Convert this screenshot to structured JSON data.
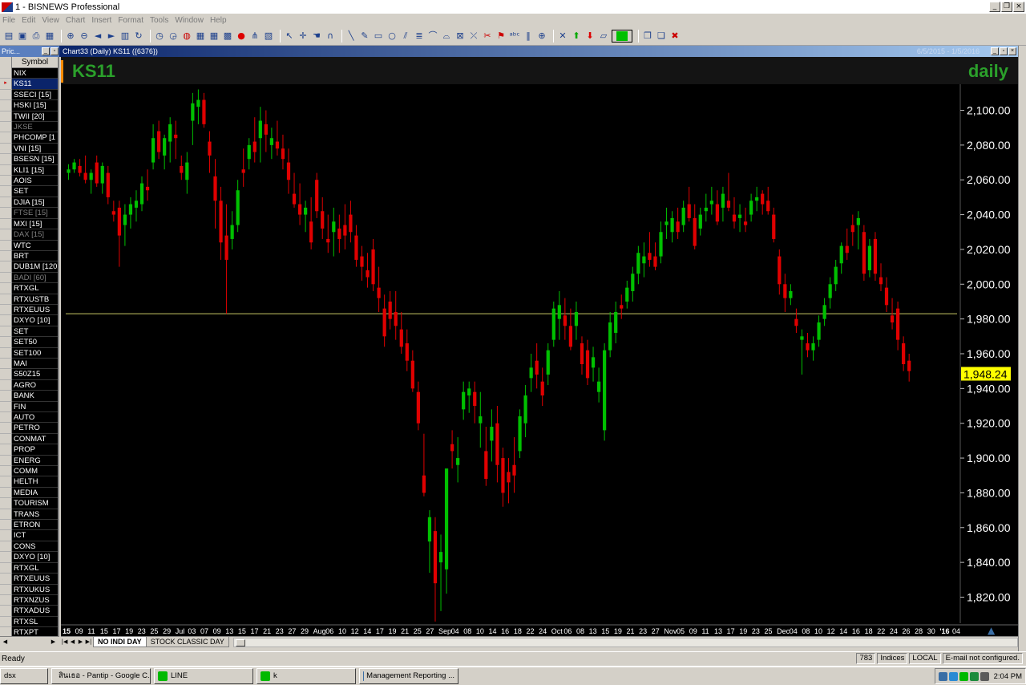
{
  "window": {
    "title": "1 - BISNEWS Professional"
  },
  "menu": [
    "File",
    "Edit",
    "View",
    "Chart",
    "Insert",
    "Format",
    "Tools",
    "Window",
    "Help"
  ],
  "toolbar_icons": [
    "open-icon",
    "save-icon",
    "print-icon",
    "layout-icon",
    "zoom-in-icon",
    "zoom-out-icon",
    "pan-left-icon",
    "pan-right-icon",
    "chart-type-icon",
    "refresh-icon",
    "clock-icon",
    "history-icon",
    "globe-icon",
    "table-icon",
    "grid-icon",
    "grid2-icon",
    "alert-icon",
    "indicator-icon",
    "compare-icon",
    "pointer-icon",
    "crosshair-icon",
    "hand-icon",
    "magnet-icon",
    "line-icon",
    "pen-icon",
    "rect-icon",
    "circle-icon",
    "channel-icon",
    "fib-icon",
    "text-icon",
    "arc-icon",
    "pattern-icon",
    "gann-icon",
    "cut-icon",
    "marker-icon",
    "abc-icon",
    "bars-icon",
    "target-icon",
    "erase-icon",
    "up-arrow-icon",
    "down-arrow-icon",
    "minichart-icon",
    "color-picker-icon",
    "cascade-icon",
    "tile-icon",
    "close-all-icon"
  ],
  "symbol_panel": {
    "title": "Pric...",
    "header": "Symbol",
    "selected_index": 1,
    "symbols": [
      {
        "name": "NIX",
        "dim": false
      },
      {
        "name": "KS11",
        "dim": false
      },
      {
        "name": "SSECI [15]",
        "dim": false
      },
      {
        "name": "HSKI [15]",
        "dim": false
      },
      {
        "name": "TWII [20]",
        "dim": false
      },
      {
        "name": "JKSE",
        "dim": true
      },
      {
        "name": "PHCOMP [1",
        "dim": false
      },
      {
        "name": "VNI [15]",
        "dim": false
      },
      {
        "name": "BSESN [15]",
        "dim": false
      },
      {
        "name": "KLI1 [15]",
        "dim": false
      },
      {
        "name": "AOIS",
        "dim": false
      },
      {
        "name": "SET",
        "dim": false
      },
      {
        "name": "DJIA [15]",
        "dim": false
      },
      {
        "name": "FTSE [15]",
        "dim": true
      },
      {
        "name": "MXI [15]",
        "dim": false
      },
      {
        "name": "DAX [15]",
        "dim": true
      },
      {
        "name": "WTC",
        "dim": false
      },
      {
        "name": "BRT",
        "dim": false
      },
      {
        "name": "DUB1M [120",
        "dim": false
      },
      {
        "name": "BADI [60]",
        "dim": true
      },
      {
        "name": "RTXGL",
        "dim": false
      },
      {
        "name": "RTXUSTB",
        "dim": false
      },
      {
        "name": "RTXEUUS",
        "dim": false
      },
      {
        "name": "DXYO [10]",
        "dim": false
      },
      {
        "name": "SET",
        "dim": false
      },
      {
        "name": "SET50",
        "dim": false
      },
      {
        "name": "SET100",
        "dim": false
      },
      {
        "name": "MAI",
        "dim": false
      },
      {
        "name": "S50Z15",
        "dim": false
      },
      {
        "name": "AGRO",
        "dim": false
      },
      {
        "name": "BANK",
        "dim": false
      },
      {
        "name": "FIN",
        "dim": false
      },
      {
        "name": "AUTO",
        "dim": false
      },
      {
        "name": "PETRO",
        "dim": false
      },
      {
        "name": "CONMAT",
        "dim": false
      },
      {
        "name": "PROP",
        "dim": false
      },
      {
        "name": "ENERG",
        "dim": false
      },
      {
        "name": "COMM",
        "dim": false
      },
      {
        "name": "HELTH",
        "dim": false
      },
      {
        "name": "MEDIA",
        "dim": false
      },
      {
        "name": "TOURISM",
        "dim": false
      },
      {
        "name": "TRANS",
        "dim": false
      },
      {
        "name": "ETRON",
        "dim": false
      },
      {
        "name": "ICT",
        "dim": false
      },
      {
        "name": "CONS",
        "dim": false
      },
      {
        "name": "DXYO [10]",
        "dim": false
      },
      {
        "name": "RTXGL",
        "dim": false
      },
      {
        "name": "RTXEUUS",
        "dim": false
      },
      {
        "name": "RTXUKUS",
        "dim": false
      },
      {
        "name": "RTXNZUS",
        "dim": false
      },
      {
        "name": "RTXADUS",
        "dim": false
      },
      {
        "name": "RTXSL",
        "dim": false
      },
      {
        "name": "RTXPT",
        "dim": false
      }
    ]
  },
  "chart_window": {
    "title": "Chart33 (Daily)  KS11 ({6376})",
    "date_range": "6/5/2015 - 1/5/2016",
    "symbol": "KS11",
    "period": "daily"
  },
  "chart_data": {
    "type": "candlestick",
    "symbol": "KS11",
    "period": "daily",
    "ylim": [
      1805,
      2115
    ],
    "yticks": [
      "2,100.00",
      "2,080.00",
      "2,060.00",
      "2,040.00",
      "2,020.00",
      "2,000.00",
      "1,980.00",
      "1,960.00",
      "1,940.00",
      "1,920.00",
      "1,900.00",
      "1,880.00",
      "1,860.00",
      "1,840.00",
      "1,820.00"
    ],
    "ytick_values": [
      2100,
      2080,
      2060,
      2040,
      2020,
      2000,
      1980,
      1960,
      1940,
      1920,
      1900,
      1880,
      1860,
      1840,
      1820
    ],
    "horizontal_line": 1983,
    "last_price_label": "1,948.24",
    "last_price": 1948.24,
    "colors": {
      "up": "#00c000",
      "down": "#e00000",
      "hline": "#c8c864",
      "last_badge": "#ffff00"
    },
    "xtick_labels": [
      "15",
      "09",
      "11",
      "15",
      "17",
      "19",
      "23",
      "25",
      "29",
      "Jul",
      "03",
      "07",
      "09",
      "13",
      "15",
      "17",
      "21",
      "23",
      "27",
      "29",
      "Aug",
      "06",
      "10",
      "12",
      "14",
      "17",
      "19",
      "21",
      "25",
      "27",
      "Sep",
      "04",
      "08",
      "10",
      "14",
      "16",
      "18",
      "22",
      "24",
      "Oct",
      "06",
      "08",
      "13",
      "15",
      "19",
      "21",
      "23",
      "27",
      "Nov",
      "05",
      "09",
      "11",
      "13",
      "17",
      "19",
      "23",
      "25",
      "Dec",
      "04",
      "08",
      "10",
      "12",
      "14",
      "16",
      "18",
      "22",
      "24",
      "26",
      "28",
      "30",
      "'16",
      "04"
    ],
    "bold_xticks": [
      "15",
      "'16"
    ],
    "candles": [
      [
        2064,
        2069,
        2060,
        2066
      ],
      [
        2066,
        2072,
        2064,
        2070
      ],
      [
        2068,
        2072,
        2062,
        2064
      ],
      [
        2064,
        2074,
        2058,
        2060
      ],
      [
        2060,
        2066,
        2052,
        2064
      ],
      [
        2070,
        2074,
        2056,
        2058
      ],
      [
        2058,
        2070,
        2052,
        2068
      ],
      [
        2064,
        2068,
        2046,
        2050
      ],
      [
        2042,
        2048,
        2036,
        2040
      ],
      [
        2044,
        2048,
        2010,
        2028
      ],
      [
        2034,
        2046,
        2022,
        2040
      ],
      [
        2040,
        2050,
        2032,
        2046
      ],
      [
        2044,
        2054,
        2036,
        2048
      ],
      [
        2046,
        2062,
        2042,
        2058
      ],
      [
        2056,
        2066,
        2048,
        2054
      ],
      [
        2070,
        2092,
        2066,
        2084
      ],
      [
        2088,
        2094,
        2072,
        2076
      ],
      [
        2074,
        2086,
        2066,
        2084
      ],
      [
        2082,
        2096,
        2070,
        2092
      ],
      [
        2086,
        2094,
        2072,
        2084
      ],
      [
        2068,
        2074,
        2060,
        2064
      ],
      [
        2060,
        2076,
        2052,
        2070
      ],
      [
        2094,
        2110,
        2080,
        2104
      ],
      [
        2102,
        2112,
        2092,
        2106
      ],
      [
        2106,
        2110,
        2090,
        2092
      ],
      [
        2082,
        2088,
        2064,
        2074
      ],
      [
        2062,
        2072,
        2032,
        2048
      ],
      [
        2048,
        2056,
        2014,
        2024
      ],
      [
        2028,
        2046,
        1983,
        2014
      ],
      [
        2026,
        2042,
        2020,
        2034
      ],
      [
        2034,
        2060,
        2030,
        2054
      ],
      [
        2066,
        2078,
        2056,
        2064
      ],
      [
        2072,
        2084,
        2066,
        2080
      ],
      [
        2082,
        2096,
        2070,
        2076
      ],
      [
        2084,
        2102,
        2070,
        2094
      ],
      [
        2092,
        2100,
        2076,
        2086
      ],
      [
        2080,
        2090,
        2072,
        2084
      ],
      [
        2082,
        2094,
        2074,
        2078
      ],
      [
        2078,
        2086,
        2066,
        2072
      ],
      [
        2070,
        2078,
        2052,
        2060
      ],
      [
        2052,
        2064,
        2044,
        2046
      ],
      [
        2046,
        2058,
        2034,
        2040
      ],
      [
        2040,
        2048,
        2030,
        2044
      ],
      [
        2036,
        2050,
        2020,
        2024
      ],
      [
        2060,
        2064,
        2038,
        2042
      ],
      [
        2042,
        2050,
        2026,
        2032
      ],
      [
        2026,
        2040,
        2018,
        2024
      ],
      [
        2030,
        2044,
        2016,
        2036
      ],
      [
        2032,
        2040,
        2018,
        2026
      ],
      [
        2034,
        2046,
        2020,
        2028
      ],
      [
        2040,
        2048,
        2024,
        2030
      ],
      [
        2028,
        2034,
        2010,
        2014
      ],
      [
        2016,
        2022,
        2002,
        2010
      ],
      [
        2008,
        2018,
        1998,
        2004
      ],
      [
        2020,
        2026,
        1996,
        2000
      ],
      [
        1998,
        2010,
        1984,
        1992
      ],
      [
        1986,
        1994,
        1964,
        1970
      ],
      [
        1990,
        1996,
        1974,
        1980
      ],
      [
        1984,
        1996,
        1968,
        1976
      ],
      [
        1974,
        1984,
        1960,
        1964
      ],
      [
        1966,
        1974,
        1950,
        1956
      ],
      [
        1956,
        1962,
        1938,
        1940
      ],
      [
        1938,
        1944,
        1916,
        1920
      ],
      [
        1890,
        1914,
        1878,
        1880
      ],
      [
        1852,
        1870,
        1834,
        1866
      ],
      [
        1858,
        1866,
        1806,
        1828
      ],
      [
        1840,
        1856,
        1812,
        1846
      ],
      [
        1836,
        1880,
        1822,
        1894
      ],
      [
        1908,
        1916,
        1894,
        1904
      ],
      [
        1896,
        1912,
        1886,
        1900
      ],
      [
        1928,
        1944,
        1922,
        1938
      ],
      [
        1936,
        1944,
        1926,
        1940
      ],
      [
        1938,
        1944,
        1920,
        1930
      ],
      [
        1920,
        1938,
        1906,
        1924
      ],
      [
        1904,
        1918,
        1884,
        1888
      ],
      [
        1910,
        1928,
        1898,
        1918
      ],
      [
        1920,
        1930,
        1886,
        1896
      ],
      [
        1900,
        1906,
        1872,
        1880
      ],
      [
        1892,
        1900,
        1874,
        1886
      ],
      [
        1896,
        1912,
        1880,
        1890
      ],
      [
        1904,
        1928,
        1900,
        1924
      ],
      [
        1920,
        1942,
        1912,
        1936
      ],
      [
        1946,
        1960,
        1938,
        1952
      ],
      [
        1956,
        1966,
        1940,
        1948
      ],
      [
        1944,
        1952,
        1930,
        1936
      ],
      [
        1948,
        1966,
        1942,
        1962
      ],
      [
        1968,
        1990,
        1964,
        1986
      ],
      [
        1980,
        1996,
        1968,
        1988
      ],
      [
        1982,
        1992,
        1968,
        1976
      ],
      [
        1976,
        1986,
        1962,
        1964
      ],
      [
        1976,
        1990,
        1968,
        1984
      ],
      [
        1966,
        1970,
        1948,
        1954
      ],
      [
        1962,
        1968,
        1942,
        1946
      ],
      [
        1952,
        1964,
        1944,
        1958
      ],
      [
        1938,
        1952,
        1932,
        1944
      ],
      [
        1916,
        1966,
        1910,
        1962
      ],
      [
        1962,
        1984,
        1958,
        1978
      ],
      [
        1972,
        1990,
        1966,
        1984
      ],
      [
        1988,
        1994,
        1980,
        1986
      ],
      [
        1990,
        2002,
        1986,
        1998
      ],
      [
        1996,
        2010,
        1990,
        2006
      ],
      [
        2006,
        2022,
        2000,
        2018
      ],
      [
        2012,
        2024,
        2004,
        2016
      ],
      [
        2018,
        2030,
        2010,
        2014
      ],
      [
        2016,
        2024,
        2008,
        2010
      ],
      [
        2016,
        2036,
        2012,
        2030
      ],
      [
        2034,
        2044,
        2026,
        2036
      ],
      [
        2030,
        2042,
        2024,
        2038
      ],
      [
        2036,
        2044,
        2026,
        2030
      ],
      [
        2034,
        2048,
        2030,
        2044
      ],
      [
        2046,
        2056,
        2036,
        2038
      ],
      [
        2038,
        2046,
        2020,
        2022
      ],
      [
        2032,
        2044,
        2028,
        2040
      ],
      [
        2042,
        2052,
        2036,
        2044
      ],
      [
        2046,
        2056,
        2040,
        2048
      ],
      [
        2046,
        2054,
        2034,
        2036
      ],
      [
        2044,
        2056,
        2036,
        2052
      ],
      [
        2048,
        2064,
        2042,
        2044
      ],
      [
        2040,
        2050,
        2032,
        2036
      ],
      [
        2038,
        2046,
        2030,
        2040
      ],
      [
        2036,
        2044,
        2030,
        2034
      ],
      [
        2040,
        2052,
        2036,
        2048
      ],
      [
        2048,
        2056,
        2042,
        2050
      ],
      [
        2052,
        2054,
        2040,
        2046
      ],
      [
        2048,
        2056,
        2040,
        2042
      ],
      [
        2040,
        2044,
        2024,
        2026
      ],
      [
        2016,
        2020,
        1994,
        2000
      ],
      [
        2000,
        2006,
        1984,
        1992
      ],
      [
        1992,
        2000,
        1988,
        1996
      ],
      [
        1980,
        1986,
        1972,
        1976
      ],
      [
        1968,
        1974,
        1948,
        1970
      ],
      [
        1966,
        1972,
        1958,
        1962
      ],
      [
        1962,
        1970,
        1956,
        1966
      ],
      [
        1968,
        1982,
        1964,
        1978
      ],
      [
        1980,
        1992,
        1976,
        1988
      ],
      [
        1992,
        2004,
        1986,
        2000
      ],
      [
        2000,
        2014,
        1996,
        2010
      ],
      [
        2012,
        2024,
        2006,
        2022
      ],
      [
        2022,
        2032,
        2014,
        2018
      ],
      [
        2034,
        2040,
        2022,
        2030
      ],
      [
        2034,
        2042,
        2020,
        2038
      ],
      [
        2030,
        2034,
        2002,
        2006
      ],
      [
        2008,
        2026,
        2004,
        2022
      ],
      [
        2026,
        2030,
        2002,
        2006
      ],
      [
        2004,
        2012,
        1996,
        2000
      ],
      [
        1998,
        2004,
        1984,
        1988
      ],
      [
        1982,
        1992,
        1974,
        1978
      ],
      [
        1986,
        1990,
        1962,
        1968
      ],
      [
        1966,
        1970,
        1950,
        1954
      ],
      [
        1956,
        1960,
        1944,
        1950
      ]
    ]
  },
  "tabs": [
    "NO INDI DAY",
    "STOCK CLASSIC DAY"
  ],
  "status": {
    "text": "Ready",
    "cells": [
      "783",
      "Indices",
      "LOCAL",
      "E-mail not configured."
    ]
  },
  "taskbar": {
    "items": [
      {
        "label": "dsx",
        "color": "#d4d0c8"
      },
      {
        "label": "สินเธอ - Pantip - Google C...",
        "color": "#e8a33c"
      },
      {
        "label": "LINE",
        "color": "#00b900"
      },
      {
        "label": "k",
        "color": "#00b900"
      },
      {
        "label": "Management Reporting ...",
        "color": "#3a6ea5"
      }
    ],
    "clock": "2:04 PM"
  }
}
